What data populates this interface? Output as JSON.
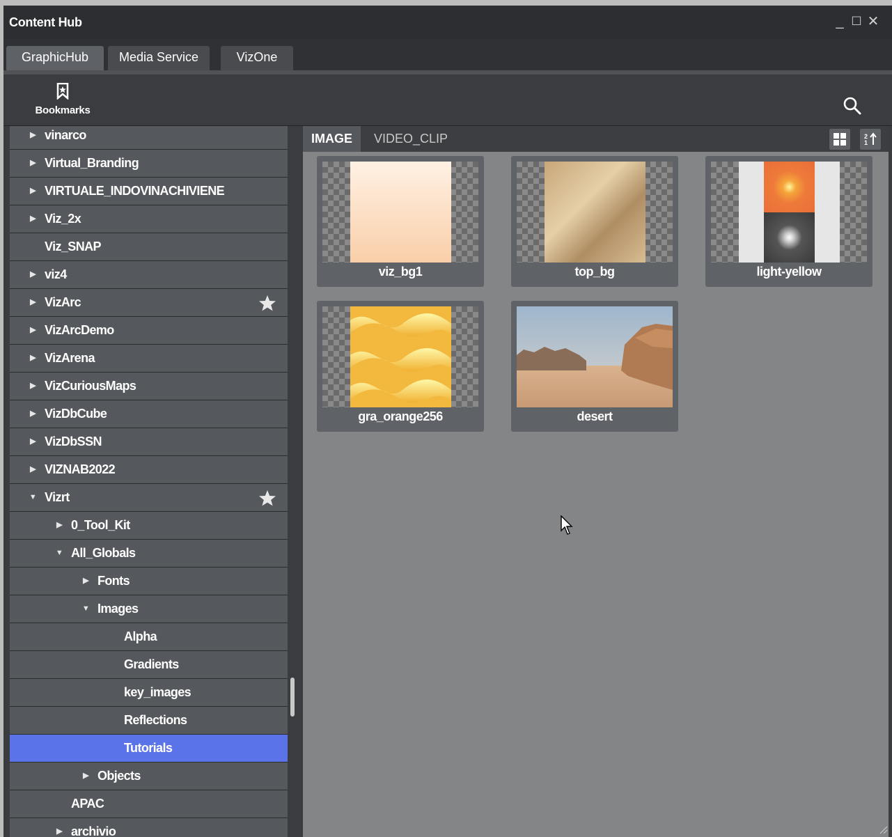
{
  "window": {
    "title": "Content Hub",
    "controls": [
      "_",
      "☐",
      "✕"
    ]
  },
  "tabs": [
    {
      "label": "GraphicHub",
      "active": true
    },
    {
      "label": "Media Service",
      "active": false
    },
    {
      "label": "VizOne",
      "active": false
    }
  ],
  "toolbar": {
    "bookmarks_label": "Bookmarks",
    "bookmark_icon": "bookmark-icon",
    "search_icon": "search-icon"
  },
  "tree": {
    "items": [
      {
        "label": "vinarco",
        "level": 0,
        "expander": "collapsed",
        "starred": false,
        "selected": false
      },
      {
        "label": "Virtual_Branding",
        "level": 0,
        "expander": "collapsed",
        "starred": false,
        "selected": false
      },
      {
        "label": "VIRTUALE_INDOVINACHIVIENE",
        "level": 0,
        "expander": "collapsed",
        "starred": false,
        "selected": false
      },
      {
        "label": "Viz_2x",
        "level": 0,
        "expander": "collapsed",
        "starred": false,
        "selected": false
      },
      {
        "label": "Viz_SNAP",
        "level": 0,
        "expander": "none",
        "starred": false,
        "selected": false
      },
      {
        "label": "viz4",
        "level": 0,
        "expander": "collapsed",
        "starred": false,
        "selected": false
      },
      {
        "label": "VizArc",
        "level": 0,
        "expander": "collapsed",
        "starred": true,
        "selected": false
      },
      {
        "label": "VizArcDemo",
        "level": 0,
        "expander": "collapsed",
        "starred": false,
        "selected": false
      },
      {
        "label": "VizArena",
        "level": 0,
        "expander": "collapsed",
        "starred": false,
        "selected": false
      },
      {
        "label": "VizCuriousMaps",
        "level": 0,
        "expander": "collapsed",
        "starred": false,
        "selected": false
      },
      {
        "label": "VizDbCube",
        "level": 0,
        "expander": "collapsed",
        "starred": false,
        "selected": false
      },
      {
        "label": "VizDbSSN",
        "level": 0,
        "expander": "collapsed",
        "starred": false,
        "selected": false
      },
      {
        "label": "VIZNAB2022",
        "level": 0,
        "expander": "collapsed",
        "starred": false,
        "selected": false
      },
      {
        "label": "Vizrt",
        "level": 0,
        "expander": "expanded",
        "starred": true,
        "selected": false
      },
      {
        "label": "0_Tool_Kit",
        "level": 1,
        "expander": "collapsed",
        "starred": false,
        "selected": false
      },
      {
        "label": "All_Globals",
        "level": 1,
        "expander": "expanded",
        "starred": false,
        "selected": false
      },
      {
        "label": "Fonts",
        "level": 2,
        "expander": "collapsed",
        "starred": false,
        "selected": false
      },
      {
        "label": "Images",
        "level": 2,
        "expander": "expanded",
        "starred": false,
        "selected": false
      },
      {
        "label": "Alpha",
        "level": 3,
        "expander": "none",
        "starred": false,
        "selected": false
      },
      {
        "label": "Gradients",
        "level": 3,
        "expander": "none",
        "starred": false,
        "selected": false
      },
      {
        "label": "key_images",
        "level": 3,
        "expander": "none",
        "starred": false,
        "selected": false
      },
      {
        "label": "Reflections",
        "level": 3,
        "expander": "none",
        "starred": false,
        "selected": false
      },
      {
        "label": "Tutorials",
        "level": 3,
        "expander": "none",
        "starred": false,
        "selected": true
      },
      {
        "label": "Objects",
        "level": 2,
        "expander": "collapsed",
        "starred": false,
        "selected": false
      },
      {
        "label": "APAC",
        "level": 1,
        "expander": "none",
        "starred": false,
        "selected": false
      },
      {
        "label": "archivio",
        "level": 1,
        "expander": "collapsed",
        "starred": false,
        "selected": false
      }
    ]
  },
  "content": {
    "tabs": [
      {
        "label": "IMAGE",
        "active": true
      },
      {
        "label": "VIDEO_CLIP",
        "active": false
      }
    ],
    "view_icons": [
      "grid-view-icon",
      "sort-icon"
    ],
    "assets": [
      {
        "name": "viz_bg1",
        "thumb": "peach-gradient"
      },
      {
        "name": "top_bg",
        "thumb": "beige-texture"
      },
      {
        "name": "light-yellow",
        "thumb": "light-glow"
      },
      {
        "name": "gra_orange256",
        "thumb": "yellow-waves"
      },
      {
        "name": "desert",
        "thumb": "desert-photo"
      }
    ]
  },
  "colors": {
    "selection": "#5b73e8",
    "panel": "#55585c",
    "content_bg": "#848586"
  }
}
